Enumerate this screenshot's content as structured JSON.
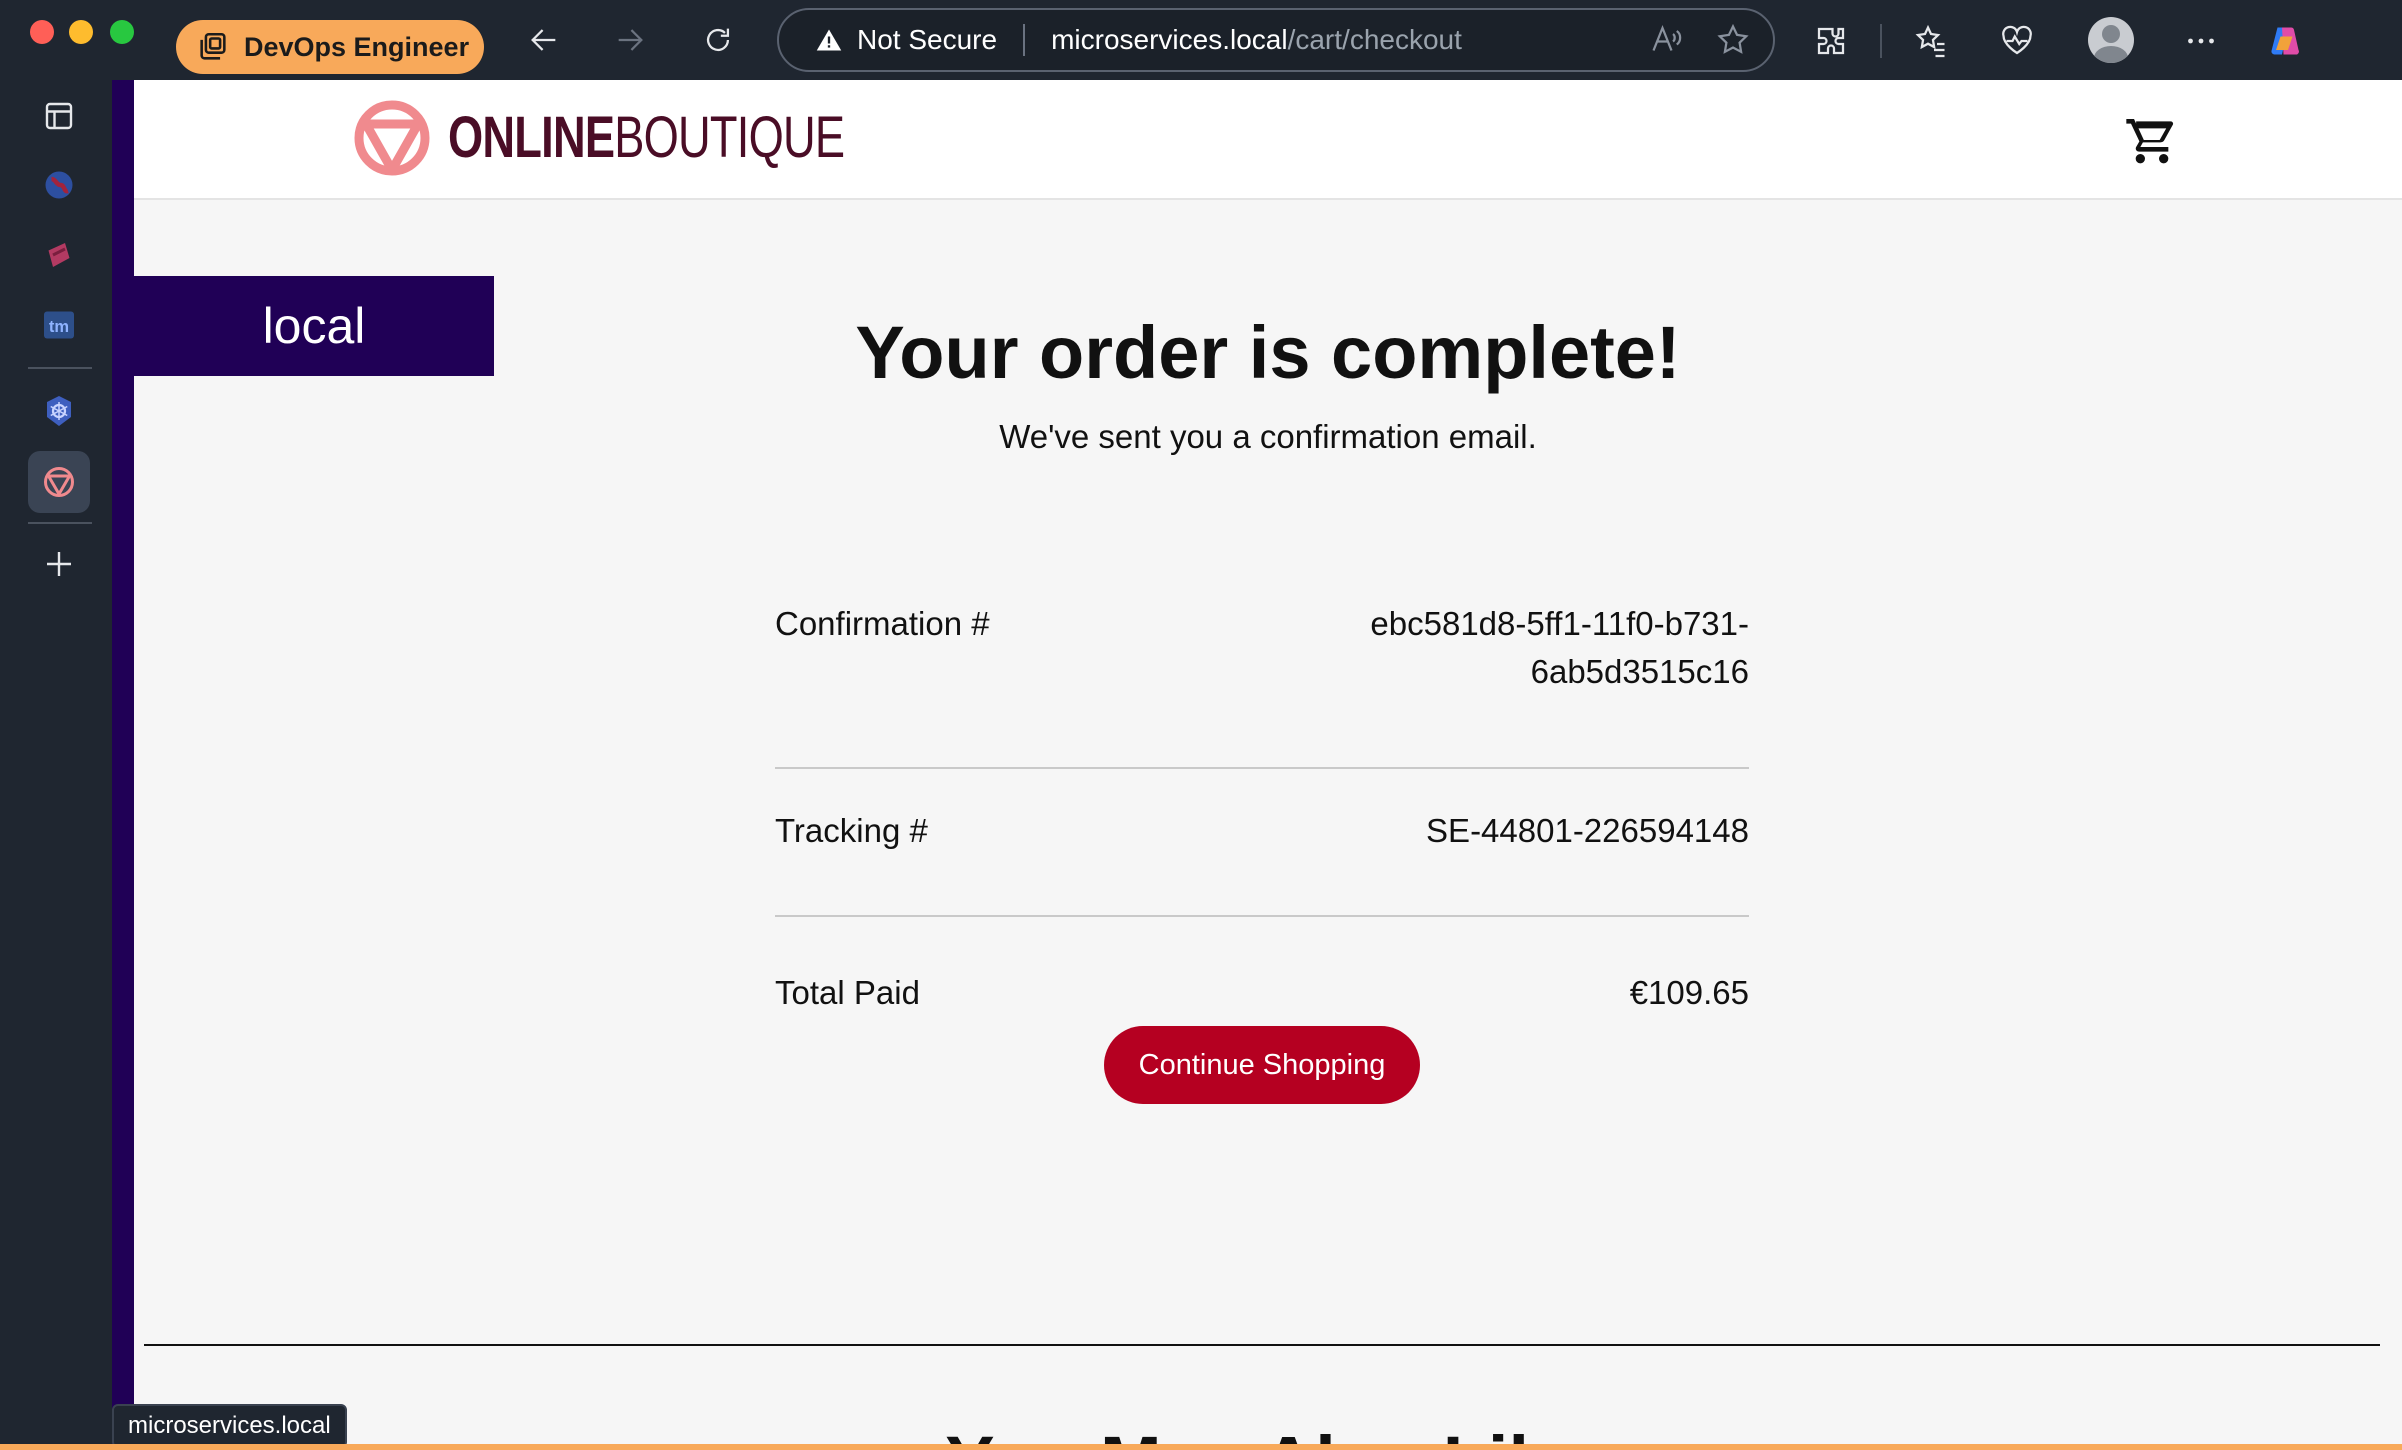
{
  "browser": {
    "profile_label": "DevOps Engineer",
    "security_label": "Not Secure",
    "url_host": "microservices.local",
    "url_path": "/cart/checkout",
    "status_url": "microservices.local",
    "profile_color": "#f8a95a"
  },
  "toolbar_icons": [
    "back-icon",
    "forward-icon",
    "refresh-icon",
    "read-aloud-icon",
    "favorite-star-icon",
    "extensions-icon",
    "favorites-icon",
    "browser-essentials-icon",
    "profile-avatar",
    "more-icon",
    "copilot-icon"
  ],
  "sidebar_icons": [
    "tab-actions-icon",
    "globe-icon",
    "pink-app-icon",
    "tm-icon",
    "kubernetes-icon",
    "online-boutique-icon",
    "add-icon"
  ],
  "site": {
    "logo_bold": "ONLINE",
    "logo_light": "BOUTIQUE",
    "brand_color": "#b50021",
    "env_badge": "local"
  },
  "order": {
    "title": "Your order is complete!",
    "subtitle": "We've sent you a confirmation email.",
    "confirmation_label": "Confirmation #",
    "confirmation_value_line1": "ebc581d8-5ff1-11f0-b731-",
    "confirmation_value_line2": "6ab5d3515c16",
    "tracking_label": "Tracking #",
    "tracking_value": "SE-44801-226594148",
    "total_label": "Total Paid",
    "total_value": "€109.65",
    "continue_label": "Continue Shopping"
  },
  "recommendations": {
    "heading": "You May Also Like"
  }
}
